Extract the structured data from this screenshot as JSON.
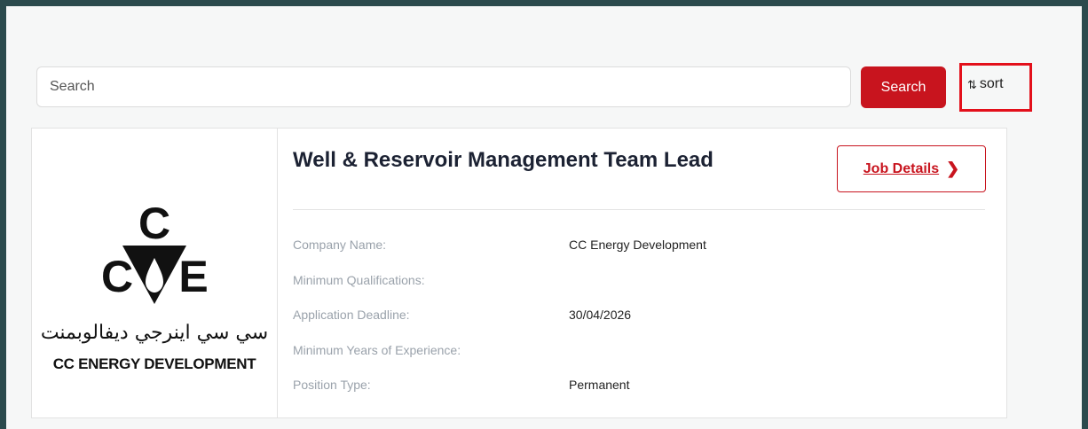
{
  "search": {
    "placeholder": "Search",
    "button_label": "Search"
  },
  "sort": {
    "icon": "sort-arrows-icon",
    "label": "sort",
    "highlight_color": "#e3101b"
  },
  "job": {
    "title": "Well & Reservoir Management Team Lead",
    "details_label": "Job Details",
    "details_icon": "chevron-right-icon",
    "fields": [
      {
        "label": "Company Name:",
        "value": "CC Energy Development"
      },
      {
        "label": "Minimum Qualifications:",
        "value": ""
      },
      {
        "label": "Application Deadline:",
        "value": "30/04/2026"
      },
      {
        "label": "Minimum Years of Experience:",
        "value": ""
      },
      {
        "label": "Position Type:",
        "value": "Permanent"
      }
    ]
  },
  "logo": {
    "arabic_text": "سي سي اينرجي ديفالوبمنت",
    "english_text": "CC ENERGY DEVELOPMENT",
    "mark_letters": [
      "C",
      "C",
      "E"
    ]
  },
  "colors": {
    "accent": "#c8141e",
    "frame": "#2b4a4d",
    "background": "#f6f7f7"
  }
}
